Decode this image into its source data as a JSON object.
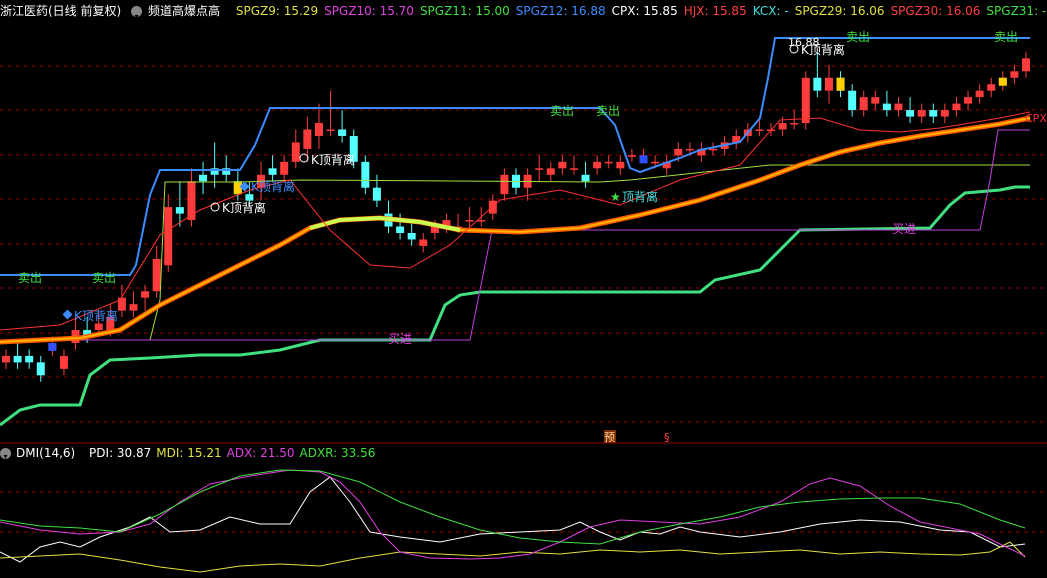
{
  "header": {
    "stock_title": "浙江医药(日线 前复权)",
    "indicator_name": "频道高爆点高",
    "readouts": [
      {
        "label": "SPGZ9: 15.29",
        "color": "#e0e040"
      },
      {
        "label": "SPGZ10: 15.70",
        "color": "#e040e0"
      },
      {
        "label": "SPGZ11: 15.00",
        "color": "#40e040"
      },
      {
        "label": "SPGZ12: 16.88",
        "color": "#3c8cff"
      },
      {
        "label": "CPX: 15.85",
        "color": "#ffffff"
      },
      {
        "label": "HJX: 15.85",
        "color": "#ff4040"
      },
      {
        "label": "KCX: -",
        "color": "#40e0e0"
      },
      {
        "label": "SPGZ29: 16.06",
        "color": "#e0e040"
      },
      {
        "label": "SPGZ30: 16.06",
        "color": "#ff4040"
      },
      {
        "label": "SPGZ31: -",
        "color": "#40e040"
      }
    ]
  },
  "chart_labels": {
    "sell": "卖出",
    "buy": "买进",
    "top_divergence": "K顶背离",
    "top_divergence_short": "顶背离",
    "high_value": "16.88",
    "cpx_tag": "CPX",
    "marker_yu": "预",
    "marker_s": "§"
  },
  "dmi_header": {
    "title": "DMI(14,6)",
    "readouts": [
      {
        "label": "PDI: 30.87",
        "color": "#ffffff"
      },
      {
        "label": "MDI: 15.21",
        "color": "#e0e040"
      },
      {
        "label": "ADX: 21.50",
        "color": "#e040e0"
      },
      {
        "label": "ADXR: 33.56",
        "color": "#40e040"
      }
    ]
  },
  "colors": {
    "up": "#ff3c3c",
    "down": "#54ffff",
    "channel_upper": "#3c8cff",
    "channel_lower": "#40e080",
    "ma_orange": "#ff8c00",
    "grid": "#8c0000"
  },
  "chart_data": {
    "type": "candlestick",
    "candles": [
      [
        12.4,
        12.6,
        12.3,
        12.5
      ],
      [
        12.5,
        12.7,
        12.3,
        12.4
      ],
      [
        12.5,
        12.6,
        12.3,
        12.4
      ],
      [
        12.4,
        12.5,
        12.1,
        12.2
      ],
      [
        12.6,
        12.8,
        12.5,
        12.7
      ],
      [
        12.3,
        12.6,
        12.2,
        12.5
      ],
      [
        12.7,
        13.1,
        12.6,
        12.9
      ],
      [
        12.9,
        13.1,
        12.7,
        12.8
      ],
      [
        12.9,
        13.2,
        12.8,
        13.0
      ],
      [
        12.9,
        13.3,
        12.8,
        13.1
      ],
      [
        13.2,
        13.6,
        13.1,
        13.4
      ],
      [
        13.2,
        13.5,
        13.1,
        13.3
      ],
      [
        13.4,
        13.6,
        13.2,
        13.5
      ],
      [
        13.5,
        14.2,
        13.4,
        14.0
      ],
      [
        13.9,
        15.0,
        13.8,
        14.8
      ],
      [
        14.8,
        15.2,
        14.5,
        14.7
      ],
      [
        14.6,
        15.4,
        14.5,
        15.2
      ],
      [
        15.3,
        15.5,
        15.0,
        15.2
      ],
      [
        15.4,
        15.8,
        15.1,
        15.3
      ],
      [
        15.4,
        15.6,
        15.2,
        15.3
      ],
      [
        15.2,
        15.4,
        14.9,
        15.0
      ],
      [
        15.0,
        15.2,
        14.8,
        14.9
      ],
      [
        15.1,
        15.5,
        14.9,
        15.3
      ],
      [
        15.4,
        15.6,
        15.2,
        15.3
      ],
      [
        15.3,
        15.6,
        15.2,
        15.5
      ],
      [
        15.5,
        16.0,
        15.4,
        15.8
      ],
      [
        15.7,
        16.2,
        15.5,
        16.0
      ],
      [
        15.9,
        16.4,
        15.7,
        16.1
      ],
      [
        16.0,
        16.6,
        15.9,
        16.0
      ],
      [
        16.0,
        16.3,
        15.8,
        15.9
      ],
      [
        15.9,
        16.0,
        15.4,
        15.5
      ],
      [
        15.5,
        15.6,
        15.0,
        15.1
      ],
      [
        15.1,
        15.3,
        14.8,
        14.9
      ],
      [
        14.7,
        14.9,
        14.4,
        14.5
      ],
      [
        14.5,
        14.7,
        14.3,
        14.4
      ],
      [
        14.4,
        14.6,
        14.2,
        14.3
      ],
      [
        14.2,
        14.4,
        14.1,
        14.3
      ],
      [
        14.4,
        14.6,
        14.3,
        14.5
      ],
      [
        14.5,
        14.7,
        14.4,
        14.6
      ],
      [
        14.5,
        14.7,
        14.4,
        14.5
      ],
      [
        14.6,
        14.8,
        14.5,
        14.6
      ],
      [
        14.6,
        14.8,
        14.5,
        14.6
      ],
      [
        14.7,
        15.0,
        14.6,
        14.9
      ],
      [
        15.0,
        15.4,
        14.9,
        15.3
      ],
      [
        15.3,
        15.4,
        15.0,
        15.1
      ],
      [
        15.1,
        15.4,
        14.9,
        15.3
      ],
      [
        15.4,
        15.6,
        15.2,
        15.4
      ],
      [
        15.3,
        15.5,
        15.2,
        15.4
      ],
      [
        15.4,
        15.6,
        15.3,
        15.5
      ],
      [
        15.4,
        15.6,
        15.3,
        15.4
      ],
      [
        15.3,
        15.5,
        15.1,
        15.2
      ],
      [
        15.4,
        15.6,
        15.3,
        15.5
      ],
      [
        15.5,
        15.6,
        15.4,
        15.5
      ],
      [
        15.4,
        15.6,
        15.3,
        15.5
      ],
      [
        15.6,
        15.7,
        15.5,
        15.6
      ],
      [
        15.6,
        15.7,
        15.5,
        15.6
      ],
      [
        15.5,
        15.6,
        15.4,
        15.5
      ],
      [
        15.4,
        15.6,
        15.3,
        15.5
      ],
      [
        15.6,
        15.8,
        15.5,
        15.7
      ],
      [
        15.7,
        15.8,
        15.6,
        15.7
      ],
      [
        15.6,
        15.8,
        15.5,
        15.7
      ],
      [
        15.7,
        15.8,
        15.6,
        15.7
      ],
      [
        15.7,
        15.9,
        15.6,
        15.8
      ],
      [
        15.8,
        16.0,
        15.7,
        15.9
      ],
      [
        15.9,
        16.1,
        15.8,
        16.0
      ],
      [
        16.0,
        16.2,
        15.9,
        16.0
      ],
      [
        16.0,
        16.1,
        15.9,
        16.0
      ],
      [
        16.0,
        16.2,
        15.9,
        16.1
      ],
      [
        16.1,
        16.3,
        16.0,
        16.1
      ],
      [
        16.1,
        16.9,
        16.0,
        16.8
      ],
      [
        16.8,
        17.2,
        16.5,
        16.6
      ],
      [
        16.6,
        17.0,
        16.4,
        16.8
      ],
      [
        16.8,
        16.9,
        16.5,
        16.6
      ],
      [
        16.6,
        16.7,
        16.2,
        16.3
      ],
      [
        16.3,
        16.6,
        16.2,
        16.5
      ],
      [
        16.4,
        16.6,
        16.3,
        16.5
      ],
      [
        16.4,
        16.6,
        16.2,
        16.3
      ],
      [
        16.3,
        16.5,
        16.2,
        16.4
      ],
      [
        16.3,
        16.5,
        16.1,
        16.2
      ],
      [
        16.2,
        16.4,
        16.1,
        16.3
      ],
      [
        16.3,
        16.4,
        16.1,
        16.2
      ],
      [
        16.2,
        16.4,
        16.1,
        16.3
      ],
      [
        16.3,
        16.5,
        16.2,
        16.4
      ],
      [
        16.4,
        16.6,
        16.3,
        16.5
      ],
      [
        16.5,
        16.7,
        16.4,
        16.6
      ],
      [
        16.6,
        16.8,
        16.5,
        16.7
      ],
      [
        16.7,
        16.9,
        16.6,
        16.8
      ],
      [
        16.8,
        17.0,
        16.7,
        16.9
      ],
      [
        16.9,
        17.2,
        16.8,
        17.1
      ]
    ]
  }
}
